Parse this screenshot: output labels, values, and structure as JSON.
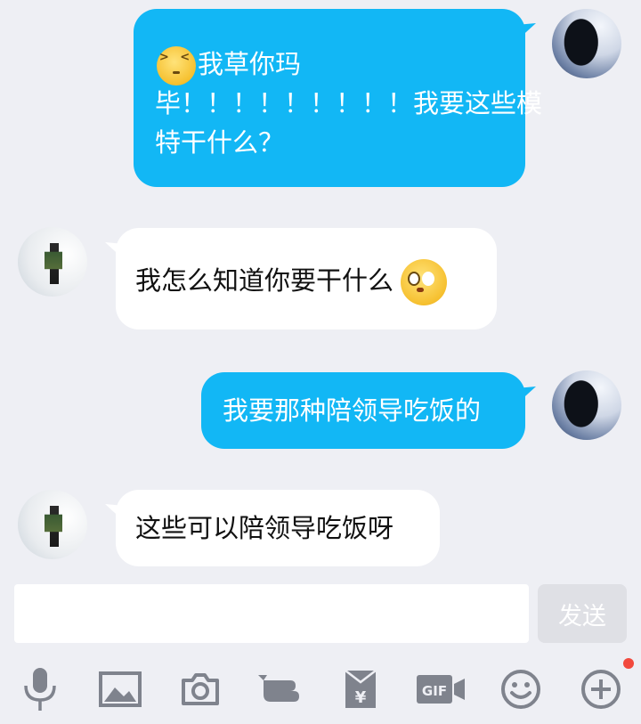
{
  "messages": [
    {
      "side": "sent",
      "emoji": "squint-face",
      "lines": [
        "我草你玛",
        "毕！！！！！！！！！我要这些模",
        "特干什么？"
      ]
    },
    {
      "side": "received",
      "text": "我怎么知道你要干什么",
      "emoji": "flushed-face"
    },
    {
      "side": "sent",
      "text": "我要那种陪领导吃饭的"
    },
    {
      "side": "received",
      "text": "这些可以陪领导吃饭呀"
    }
  ],
  "input": {
    "value": "",
    "send_label": "发送"
  },
  "toolbar": [
    "microphone-icon",
    "image-icon",
    "camera-icon",
    "poke-icon",
    "red-packet-icon",
    "gif-icon",
    "emoji-icon",
    "plus-icon"
  ],
  "colors": {
    "sent_bubble": "#12b7f5",
    "received_bubble": "#ffffff",
    "background": "#eeeff4",
    "notification_dot": "#f2493d"
  }
}
